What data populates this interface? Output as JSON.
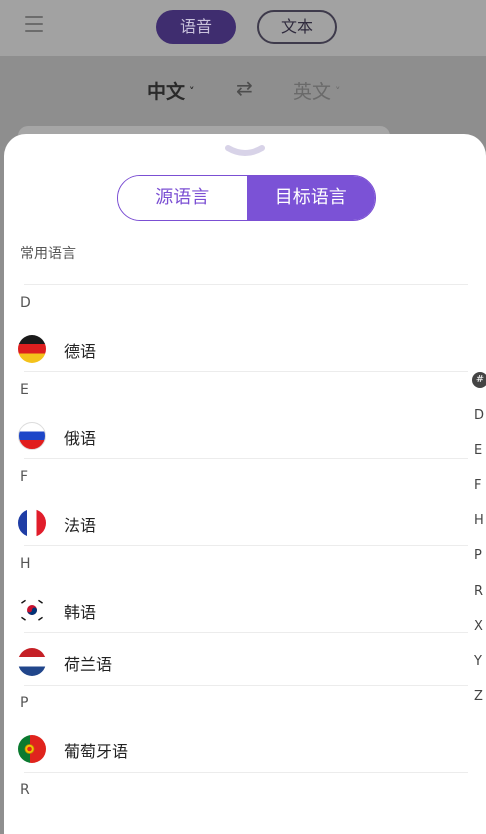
{
  "header": {
    "menu_icon": "menu-icon",
    "mode_voice": "语音",
    "mode_text": "文本"
  },
  "lang_bar": {
    "source": "中文",
    "swap_icon": "⇄",
    "target": "英文",
    "chevron": "˅"
  },
  "sheet": {
    "handle_icon": "chevron-down-icon",
    "tabs": {
      "source": "源语言",
      "target": "目标语言"
    },
    "common_label": "常用语言",
    "sections": [
      {
        "letter": "D",
        "items": [
          {
            "name": "德语",
            "flag": "de"
          }
        ]
      },
      {
        "letter": "E",
        "items": [
          {
            "name": "俄语",
            "flag": "ru"
          }
        ]
      },
      {
        "letter": "F",
        "items": [
          {
            "name": "法语",
            "flag": "fr"
          }
        ]
      },
      {
        "letter": "H",
        "items": [
          {
            "name": "韩语",
            "flag": "kr"
          },
          {
            "name": "荷兰语",
            "flag": "nl"
          }
        ]
      },
      {
        "letter": "P",
        "items": [
          {
            "name": "葡萄牙语",
            "flag": "pt"
          }
        ]
      },
      {
        "letter": "R",
        "items": []
      }
    ],
    "index": [
      "#",
      "D",
      "E",
      "F",
      "H",
      "P",
      "R",
      "X",
      "Y",
      "Z"
    ]
  },
  "colors": {
    "accent": "#7b52d6",
    "dim_overlay": "#8f8f8f"
  }
}
